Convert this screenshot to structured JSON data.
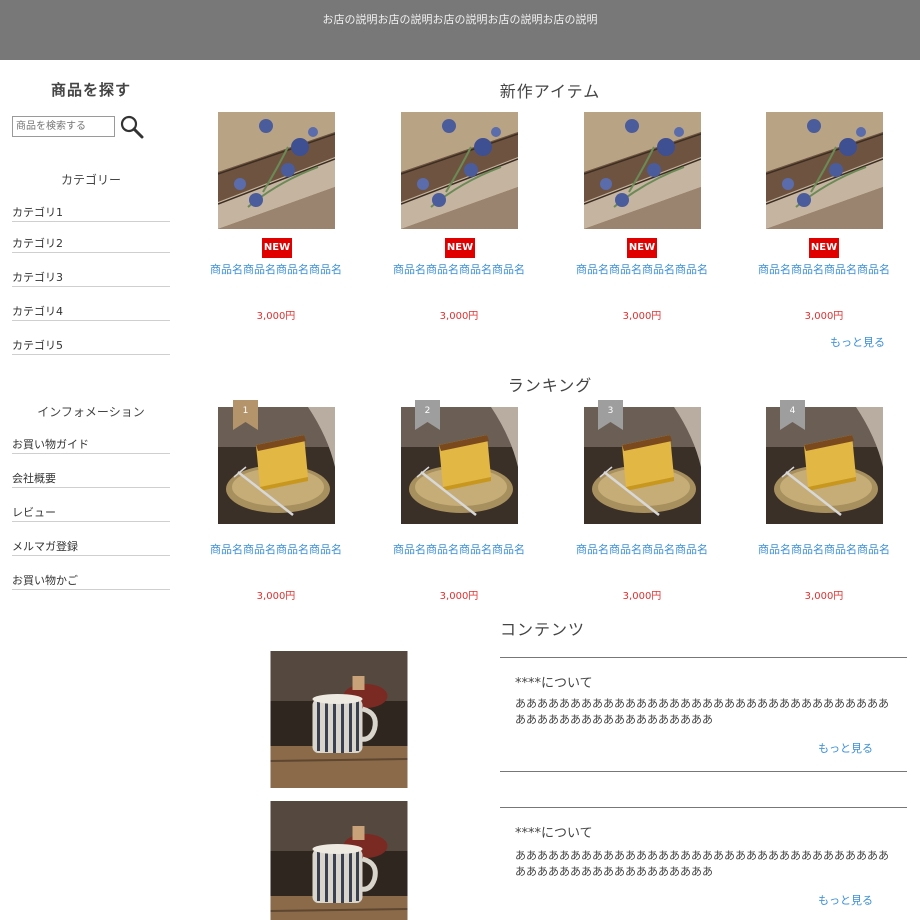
{
  "header": {
    "description": "お店の説明お店の説明お店の説明お店の説明お店の説明"
  },
  "sidebar": {
    "search_title": "商品を探す",
    "search_placeholder": "商品を検索する",
    "category_title": "カテゴリー",
    "categories": [
      "カテゴリ1",
      "カテゴリ2",
      "カテゴリ3",
      "カテゴリ4",
      "カテゴリ5"
    ],
    "info_title": "インフォメーション",
    "info_items": [
      "お買い物ガイド",
      "会社概要",
      "レビュー",
      "メルマガ登録",
      "お買い物かご"
    ]
  },
  "new_items": {
    "title": "新作アイテム",
    "badge": "NEW",
    "products": [
      {
        "name": "商品名商品名商品名商品名",
        "price": "3,000円"
      },
      {
        "name": "商品名商品名商品名商品名",
        "price": "3,000円"
      },
      {
        "name": "商品名商品名商品名商品名",
        "price": "3,000円"
      },
      {
        "name": "商品名商品名商品名商品名",
        "price": "3,000円"
      }
    ],
    "more": "もっと見る"
  },
  "ranking": {
    "title": "ランキング",
    "products": [
      {
        "rank": "1",
        "name": "商品名商品名商品名商品名",
        "price": "3,000円",
        "badge_color": "#b3946b"
      },
      {
        "rank": "2",
        "name": "商品名商品名商品名商品名",
        "price": "3,000円",
        "badge_color": "#9e9e9e"
      },
      {
        "rank": "3",
        "name": "商品名商品名商品名商品名",
        "price": "3,000円",
        "badge_color": "#9e9e9e"
      },
      {
        "rank": "4",
        "name": "商品名商品名商品名商品名",
        "price": "3,000円",
        "badge_color": "#9e9e9e"
      }
    ]
  },
  "contents": {
    "title": "コンテンツ",
    "items": [
      {
        "heading": "****について",
        "body": "ああああああああああああああああああああああああああああああああああああああああああああああああああああ",
        "more": "もっと見る"
      },
      {
        "heading": "****について",
        "body": "ああああああああああああああああああああああああああああああああああああああああああああああああああああ",
        "more": "もっと見る"
      }
    ]
  },
  "colors": {
    "link": "#3a8fd8",
    "price": "#e03030",
    "new_badge": "#e00000",
    "banner": "#787878"
  }
}
